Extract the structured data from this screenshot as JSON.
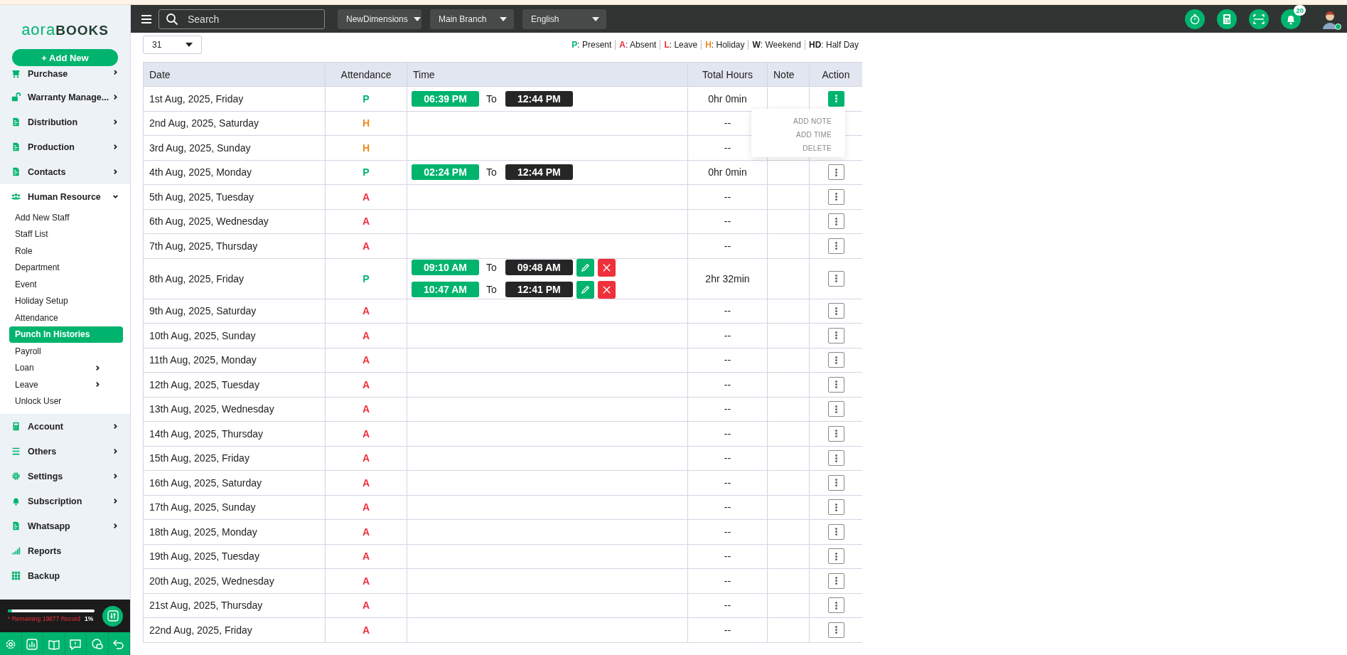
{
  "sidebar": {
    "logo": {
      "part_1": "aora",
      "part_2": "BOOKS"
    },
    "add_button": "+ Add New",
    "items": [
      {
        "label": "Purchase",
        "expanded": false
      },
      {
        "label": "Warranty Manage...",
        "expanded": false
      },
      {
        "label": "Distribution",
        "expanded": false
      },
      {
        "label": "Production",
        "expanded": false
      },
      {
        "label": "Contacts",
        "expanded": false
      },
      {
        "label": "Human Resource",
        "expanded": true,
        "children": [
          {
            "label": "Add New Staff",
            "selected": false
          },
          {
            "label": "Staff List",
            "selected": false
          },
          {
            "label": "Role",
            "selected": false
          },
          {
            "label": "Department",
            "selected": false
          },
          {
            "label": "Event",
            "selected": false
          },
          {
            "label": "Holiday Setup",
            "selected": false
          },
          {
            "label": "Attendance",
            "selected": false
          },
          {
            "label": "Punch In Histories",
            "selected": true
          },
          {
            "label": "Payroll",
            "selected": false
          },
          {
            "label": "Loan",
            "selected": false,
            "expanded": false
          },
          {
            "label": "Leave",
            "selected": false,
            "expanded": false
          },
          {
            "label": "Unlock User",
            "selected": false
          }
        ]
      },
      {
        "label": "Account",
        "expanded": false
      },
      {
        "label": "Others",
        "expanded": false
      },
      {
        "label": "Settings",
        "expanded": false
      },
      {
        "label": "Subscription",
        "expanded": false
      },
      {
        "label": "Whatsapp",
        "expanded": false
      },
      {
        "label": "Reports"
      },
      {
        "label": "Backup"
      }
    ],
    "usage": {
      "level": 0.01,
      "text": "* Remaining 19877 Record",
      "percent": "1%"
    }
  },
  "topbar": {
    "search": {
      "placeholder": "Search"
    },
    "dropdowns": [
      "NewDimensions",
      "Main Branch",
      "English"
    ],
    "notification_count": "20"
  },
  "day_select": "31",
  "legend": [
    {
      "code": "P",
      "label": ": Present",
      "color": "#00b46e"
    },
    {
      "code": "A",
      "label": ": Absent",
      "color": "#f0303a"
    },
    {
      "code": "L",
      "label": ": Leave",
      "color": "#f0303a"
    },
    {
      "code": "H",
      "label": ": Holiday",
      "color": "#f08a1c"
    },
    {
      "code": "W",
      "label": ": Weekend",
      "color": "#222222"
    },
    {
      "code": "HD",
      "label": ": Half Day",
      "color": "#222222"
    }
  ],
  "table": {
    "columns": [
      "Date",
      "Attendance",
      "Time",
      "Total Hours",
      "Note",
      "Action"
    ],
    "action_menu": [
      "ADD NOTE",
      "ADD TIME",
      "DELETE"
    ],
    "rows": [
      {
        "date": "1st Aug, 2025, Friday",
        "attendance": "P",
        "color": "#00b46e",
        "punches": [
          {
            "in": "06:39 PM",
            "to": "To",
            "out": "12:44 PM",
            "editable": false
          }
        ],
        "total": "0hr 0min",
        "menu_open": true
      },
      {
        "date": "2nd Aug, 2025, Saturday",
        "attendance": "H",
        "color": "#f08a1c",
        "total": "--",
        "menu_open": false
      },
      {
        "date": "3rd Aug, 2025, Sunday",
        "attendance": "H",
        "color": "#f08a1c",
        "total": "--",
        "menu_open": false
      },
      {
        "date": "4th Aug, 2025, Monday",
        "attendance": "P",
        "color": "#00b46e",
        "punches": [
          {
            "in": "02:24 PM",
            "to": "To",
            "out": "12:44 PM",
            "editable": false
          }
        ],
        "total": "0hr 0min",
        "menu_open": false
      },
      {
        "date": "5th Aug, 2025, Tuesday",
        "attendance": "A",
        "color": "#f0303a",
        "total": "--",
        "menu_open": false
      },
      {
        "date": "6th Aug, 2025, Wednesday",
        "attendance": "A",
        "color": "#f0303a",
        "total": "--",
        "menu_open": false
      },
      {
        "date": "7th Aug, 2025, Thursday",
        "attendance": "A",
        "color": "#f0303a",
        "total": "--",
        "menu_open": false
      },
      {
        "date": "8th Aug, 2025, Friday",
        "attendance": "P",
        "color": "#00b46e",
        "punches": [
          {
            "in": "09:10 AM",
            "to": "To",
            "out": "09:48 AM",
            "editable": true
          },
          {
            "in": "10:47 AM",
            "to": "To",
            "out": "12:41 PM",
            "editable": true
          }
        ],
        "total": "2hr 32min",
        "menu_open": false
      },
      {
        "date": "9th Aug, 2025, Saturday",
        "attendance": "A",
        "color": "#f0303a",
        "total": "--",
        "menu_open": false
      },
      {
        "date": "10th Aug, 2025, Sunday",
        "attendance": "A",
        "color": "#f0303a",
        "total": "--",
        "menu_open": false
      },
      {
        "date": "11th Aug, 2025, Monday",
        "attendance": "A",
        "color": "#f0303a",
        "total": "--",
        "menu_open": false
      },
      {
        "date": "12th Aug, 2025, Tuesday",
        "attendance": "A",
        "color": "#f0303a",
        "total": "--",
        "menu_open": false
      },
      {
        "date": "13th Aug, 2025, Wednesday",
        "attendance": "A",
        "color": "#f0303a",
        "total": "--",
        "menu_open": false
      },
      {
        "date": "14th Aug, 2025, Thursday",
        "attendance": "A",
        "color": "#f0303a",
        "total": "--",
        "menu_open": false
      },
      {
        "date": "15th Aug, 2025, Friday",
        "attendance": "A",
        "color": "#f0303a",
        "total": "--",
        "menu_open": false
      },
      {
        "date": "16th Aug, 2025, Saturday",
        "attendance": "A",
        "color": "#f0303a",
        "total": "--",
        "menu_open": false
      },
      {
        "date": "17th Aug, 2025, Sunday",
        "attendance": "A",
        "color": "#f0303a",
        "total": "--",
        "menu_open": false
      },
      {
        "date": "18th Aug, 2025, Monday",
        "attendance": "A",
        "color": "#f0303a",
        "total": "--",
        "menu_open": false
      },
      {
        "date": "19th Aug, 2025, Tuesday",
        "attendance": "A",
        "color": "#f0303a",
        "total": "--",
        "menu_open": false
      },
      {
        "date": "20th Aug, 2025, Wednesday",
        "attendance": "A",
        "color": "#f0303a",
        "total": "--",
        "menu_open": false
      },
      {
        "date": "21st Aug, 2025, Thursday",
        "attendance": "A",
        "color": "#f0303a",
        "total": "--",
        "menu_open": false
      },
      {
        "date": "22nd Aug, 2025, Friday",
        "attendance": "A",
        "color": "#f0303a",
        "total": "--",
        "menu_open": false
      }
    ]
  }
}
